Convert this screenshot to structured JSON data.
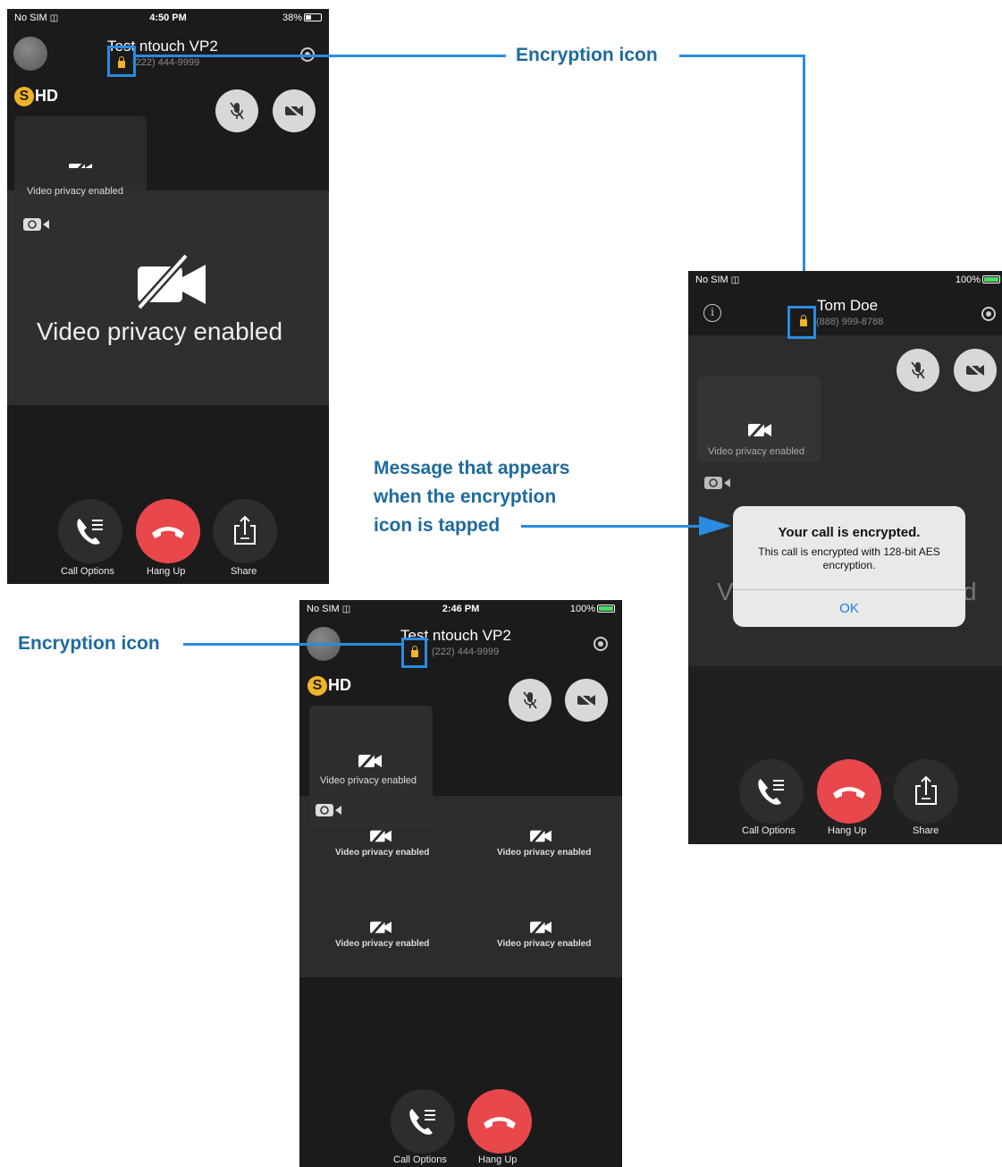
{
  "callouts": {
    "encryption_icon_top": "Encryption icon",
    "encryption_icon_left": "Encryption icon",
    "message_line1": "Message that appears",
    "message_line2": "when the encryption",
    "message_line3": "icon is tapped"
  },
  "phone1": {
    "status": {
      "carrier": "No SIM",
      "time": "4:50 PM",
      "battery": "38%",
      "battery_level": 0.38
    },
    "contact_name": "Test ntouch VP2",
    "contact_number": "(222) 444-9999",
    "logo_text": "HD",
    "pip_label": "Video privacy enabled",
    "main_label": "Video privacy enabled",
    "controls": {
      "call_options": "Call Options",
      "hang_up": "Hang Up",
      "share": "Share"
    }
  },
  "phone2": {
    "status": {
      "carrier": "No SIM",
      "time": "",
      "battery": "100%",
      "battery_level": 1.0
    },
    "contact_name": "Tom Doe",
    "contact_number": "(888) 999-8788",
    "pip_label": "Video privacy enabled",
    "background_text_left": "V",
    "background_text_right": "d",
    "alert": {
      "title": "Your call is encrypted.",
      "body": "This call is encrypted with 128-bit AES encryption.",
      "ok": "OK"
    },
    "controls": {
      "call_options": "Call Options",
      "hang_up": "Hang Up",
      "share": "Share"
    }
  },
  "phone3": {
    "status": {
      "carrier": "No SIM",
      "time": "2:46 PM",
      "battery": "100%",
      "battery_level": 1.0
    },
    "contact_name": "Test ntouch VP2",
    "contact_number": "(222) 444-9999",
    "logo_text": "HD",
    "pip_label": "Video privacy enabled",
    "grid_labels": [
      "Video privacy enabled",
      "Video privacy enabled",
      "Video privacy enabled",
      "Video privacy enabled"
    ],
    "controls": {
      "call_options": "Call Options",
      "hang_up": "Hang Up"
    }
  },
  "colors": {
    "callout_text": "#1e6a9e",
    "callout_line": "#2a8be0",
    "lock": "#f0b429",
    "hang_up_red": "#e8474c",
    "alert_ok": "#1f7ae0"
  }
}
